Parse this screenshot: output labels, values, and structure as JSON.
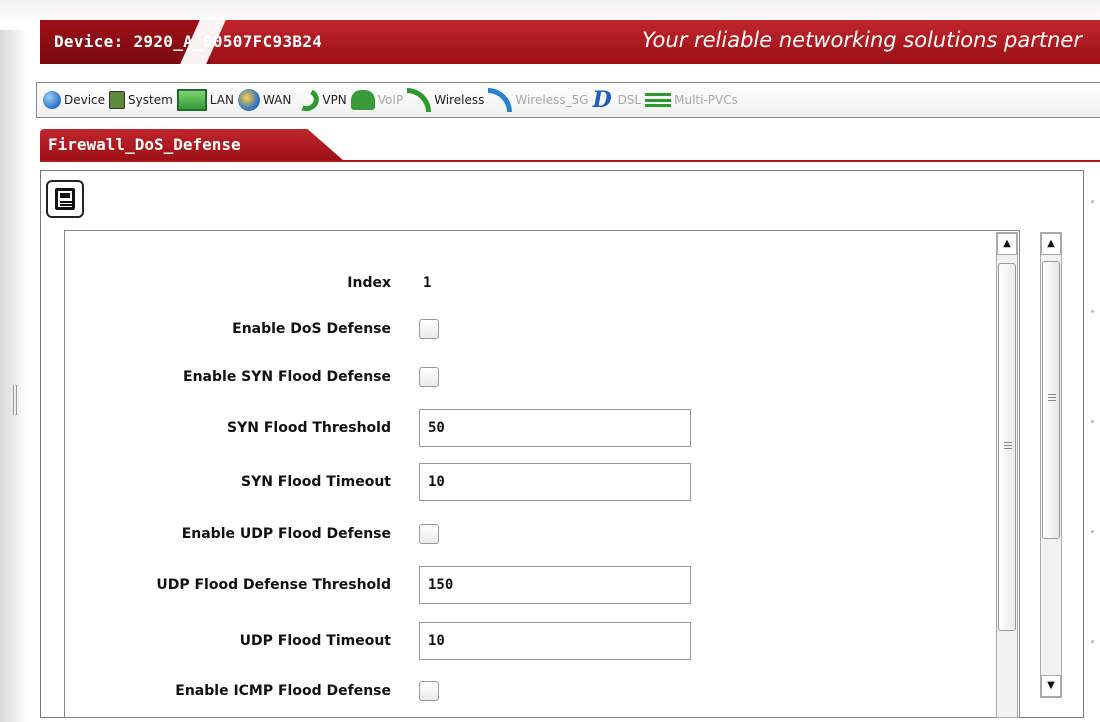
{
  "header": {
    "device_title": "Device: 2920_A_00507FC93B24",
    "tagline": "Your reliable networking solutions partner"
  },
  "nav": {
    "items": [
      {
        "label": "Device",
        "icon": "globe-icon",
        "dim": false
      },
      {
        "label": "System",
        "icon": "system-icon",
        "dim": false
      },
      {
        "label": "LAN",
        "icon": "monitor-icon",
        "dim": false
      },
      {
        "label": "WAN",
        "icon": "wan-globe-icon",
        "dim": false
      },
      {
        "label": "VPN",
        "icon": "vpn-icon",
        "dim": false
      },
      {
        "label": "VoIP",
        "icon": "phone-icon",
        "dim": true
      },
      {
        "label": "Wireless",
        "icon": "wifi-icon",
        "dim": false
      },
      {
        "label": "Wireless_5G",
        "icon": "wifi-5g-icon",
        "dim": true
      },
      {
        "label": "DSL",
        "icon": "dsl-icon",
        "dim": true
      },
      {
        "label": "Multi-PVCs",
        "icon": "pvc-icon",
        "dim": true
      }
    ]
  },
  "tab": {
    "label": "Firewall_DoS_Defense"
  },
  "form": {
    "index_label": "Index",
    "index_value": "1",
    "enable_dos_label": "Enable DoS Defense",
    "enable_syn_label": "Enable SYN Flood Defense",
    "syn_threshold_label": "SYN Flood Threshold",
    "syn_threshold_value": "50",
    "syn_timeout_label": "SYN Flood Timeout",
    "syn_timeout_value": "10",
    "enable_udp_label": "Enable UDP Flood Defense",
    "udp_threshold_label": "UDP Flood Defense Threshold",
    "udp_threshold_value": "150",
    "udp_timeout_label": "UDP Flood Timeout",
    "udp_timeout_value": "10",
    "enable_icmp_label": "Enable ICMP Flood Defense"
  },
  "colors": {
    "brand_red": "#b0181e",
    "header_dark": "#7a0a10"
  }
}
